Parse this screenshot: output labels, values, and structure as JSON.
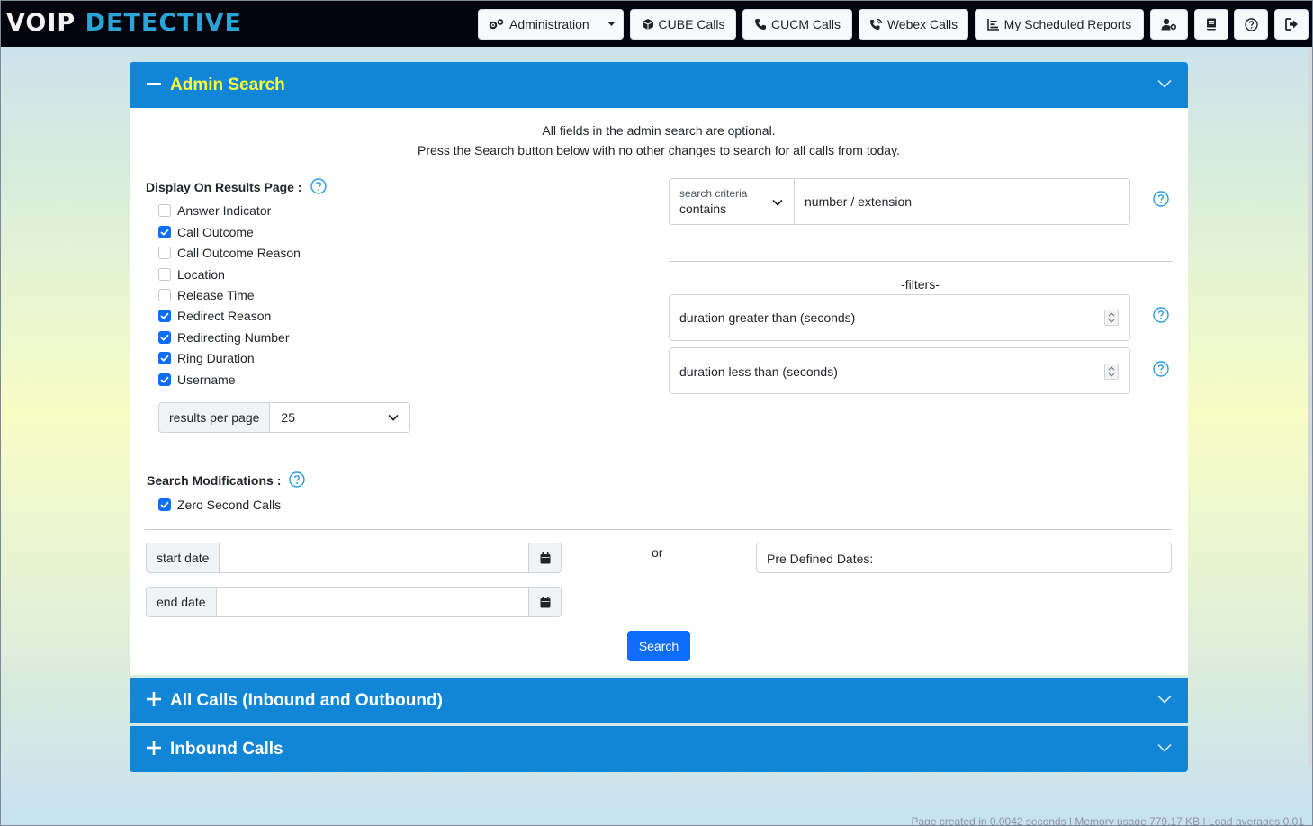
{
  "app": {
    "logo_voip": "VOIP",
    "logo_detective": "DETECTIVE"
  },
  "nav": {
    "administration": "Administration",
    "cube_calls": "CUBE Calls",
    "cucm_calls": "CUCM Calls",
    "webex_calls": "Webex Calls",
    "scheduled_reports": "My Scheduled Reports",
    "icons": [
      "user-gear-icon",
      "book-icon",
      "help-circle-icon",
      "logout-icon"
    ]
  },
  "admin_search": {
    "title": "Admin Search",
    "intro_line1": "All fields in the admin search are optional.",
    "intro_line2": "Press the Search button below with no other changes to search for all calls from today.",
    "display_label": "Display On Results Page :",
    "display_options": [
      {
        "label": "Answer Indicator",
        "checked": false
      },
      {
        "label": "Call Outcome",
        "checked": true
      },
      {
        "label": "Call Outcome Reason",
        "checked": false
      },
      {
        "label": "Location",
        "checked": false
      },
      {
        "label": "Release Time",
        "checked": false
      },
      {
        "label": "Redirect Reason",
        "checked": true
      },
      {
        "label": "Redirecting Number",
        "checked": true
      },
      {
        "label": "Ring Duration",
        "checked": true
      },
      {
        "label": "Username",
        "checked": true
      }
    ],
    "results_per_page_label": "results per page",
    "results_per_page_value": "25",
    "search_criteria_label": "search criteria",
    "search_criteria_value": "contains",
    "number_placeholder": "number / extension",
    "filters_label": "-filters-",
    "duration_greater_placeholder": "duration greater than (seconds)",
    "duration_less_placeholder": "duration less than (seconds)",
    "modifications_label": "Search Modifications :",
    "zero_second_calls": {
      "label": "Zero Second Calls",
      "checked": true
    },
    "start_date_label": "start date",
    "end_date_label": "end date",
    "or_label": "or",
    "predefined_dates": "Pre Defined Dates:",
    "search_button": "Search"
  },
  "panels": {
    "all_calls": "All Calls (Inbound and Outbound)",
    "inbound_calls": "Inbound Calls"
  },
  "footer": "Page created in 0.0042 seconds | Memory usage 779.17 KB | Load averages 0.01",
  "colors": {
    "navbar_bg": "#04040e",
    "panel_header": "#1286d6",
    "admin_title": "#ffff3c",
    "primary": "#0d6efd",
    "help_icon": "#2b9be0"
  }
}
